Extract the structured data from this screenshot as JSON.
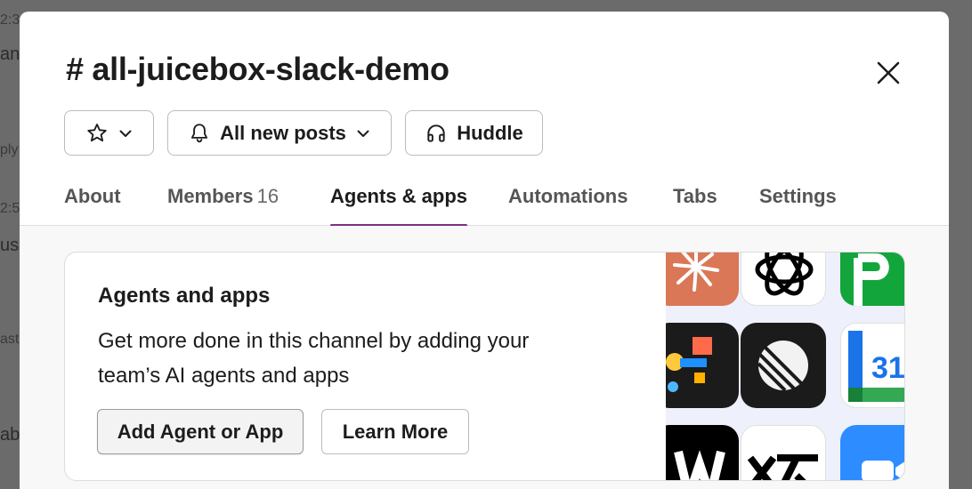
{
  "background_fragments": [
    "2:3",
    "an",
    "ply",
    "2:5",
    "us",
    "ast",
    "ab"
  ],
  "channel": {
    "title": "# all-juicebox-slack-demo"
  },
  "toolbar": {
    "notifications_label": "All new posts",
    "huddle_label": "Huddle"
  },
  "tabs": [
    {
      "label": "About"
    },
    {
      "label": "Members",
      "count": "16"
    },
    {
      "label": "Agents & apps",
      "active": true
    },
    {
      "label": "Automations"
    },
    {
      "label": "Tabs"
    },
    {
      "label": "Settings"
    }
  ],
  "card": {
    "title": "Agents and apps",
    "description": "Get more done in this channel by adding your team’s AI agents and apps",
    "primary_button": "Add Agent or App",
    "secondary_button": "Learn More"
  },
  "app_tiles": [
    {
      "icon": "claude-app-icon",
      "color": "#d97757"
    },
    {
      "icon": "openai-app-icon",
      "color": "#ffffff"
    },
    {
      "icon": "green-p-app-icon",
      "color": "#12a53c"
    },
    {
      "icon": "colorful-shapes-app-icon",
      "color": "#1b1b1b"
    },
    {
      "icon": "linear-app-icon",
      "color": "#1b1b1b"
    },
    {
      "icon": "google-calendar-app-icon",
      "color": "#ffffff",
      "text": "31"
    },
    {
      "icon": "black-w-app-icon",
      "color": "#000000"
    },
    {
      "icon": "black-white-app-icon",
      "color": "#ffffff"
    },
    {
      "icon": "blue-app-icon",
      "color": "#2d8cff"
    }
  ],
  "colors": {
    "active_tab_underline": "#7c3085",
    "text": "#1d1c1d"
  }
}
